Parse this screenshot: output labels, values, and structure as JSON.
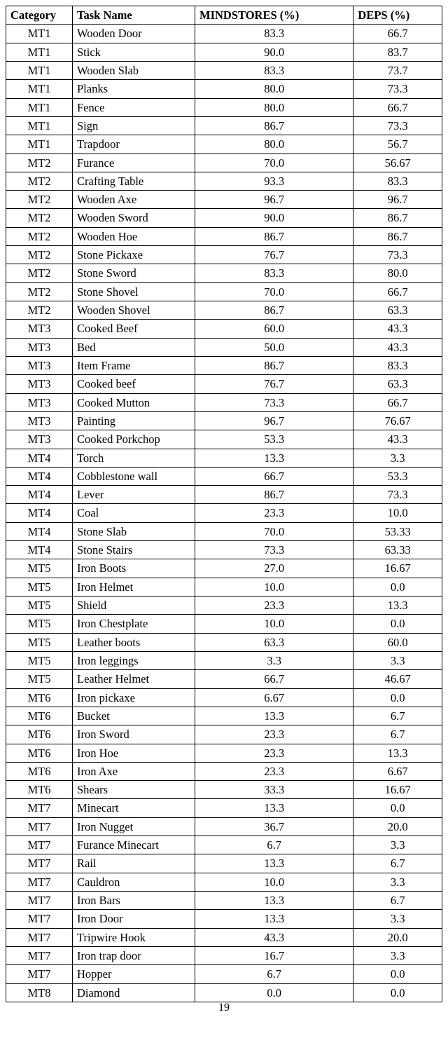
{
  "headers": {
    "category": "Category",
    "task": "Task Name",
    "mindstores": "MINDSTORES (%)",
    "deps": "DEPS (%)"
  },
  "rows": [
    {
      "category": "MT1",
      "task": "Wooden Door",
      "mindstores": "83.3",
      "deps": "66.7"
    },
    {
      "category": "MT1",
      "task": "Stick",
      "mindstores": "90.0",
      "deps": "83.7"
    },
    {
      "category": "MT1",
      "task": "Wooden Slab",
      "mindstores": "83.3",
      "deps": "73.7"
    },
    {
      "category": "MT1",
      "task": "Planks",
      "mindstores": "80.0",
      "deps": "73.3"
    },
    {
      "category": "MT1",
      "task": "Fence",
      "mindstores": "80.0",
      "deps": "66.7"
    },
    {
      "category": "MT1",
      "task": "Sign",
      "mindstores": "86.7",
      "deps": "73.3"
    },
    {
      "category": "MT1",
      "task": "Trapdoor",
      "mindstores": "80.0",
      "deps": "56.7"
    },
    {
      "category": "MT2",
      "task": "Furance",
      "mindstores": "70.0",
      "deps": "56.67"
    },
    {
      "category": "MT2",
      "task": "Crafting Table",
      "mindstores": "93.3",
      "deps": "83.3"
    },
    {
      "category": "MT2",
      "task": "Wooden Axe",
      "mindstores": "96.7",
      "deps": "96.7"
    },
    {
      "category": "MT2",
      "task": "Wooden Sword",
      "mindstores": "90.0",
      "deps": "86.7"
    },
    {
      "category": "MT2",
      "task": "Wooden Hoe",
      "mindstores": "86.7",
      "deps": "86.7"
    },
    {
      "category": "MT2",
      "task": "Stone Pickaxe",
      "mindstores": "76.7",
      "deps": "73.3"
    },
    {
      "category": "MT2",
      "task": "Stone Sword",
      "mindstores": "83.3",
      "deps": "80.0"
    },
    {
      "category": "MT2",
      "task": "Stone Shovel",
      "mindstores": "70.0",
      "deps": "66.7"
    },
    {
      "category": "MT2",
      "task": "Wooden Shovel",
      "mindstores": "86.7",
      "deps": "63.3"
    },
    {
      "category": "MT3",
      "task": "Cooked Beef",
      "mindstores": "60.0",
      "deps": "43.3"
    },
    {
      "category": "MT3",
      "task": "Bed",
      "mindstores": "50.0",
      "deps": "43.3"
    },
    {
      "category": "MT3",
      "task": "Item Frame",
      "mindstores": "86.7",
      "deps": "83.3"
    },
    {
      "category": "MT3",
      "task": "Cooked beef",
      "mindstores": "76.7",
      "deps": "63.3"
    },
    {
      "category": "MT3",
      "task": "Cooked Mutton",
      "mindstores": "73.3",
      "deps": "66.7"
    },
    {
      "category": "MT3",
      "task": "Painting",
      "mindstores": "96.7",
      "deps": "76.67"
    },
    {
      "category": "MT3",
      "task": "Cooked Porkchop",
      "mindstores": "53.3",
      "deps": "43.3"
    },
    {
      "category": "MT4",
      "task": "Torch",
      "mindstores": "13.3",
      "deps": "3.3"
    },
    {
      "category": "MT4",
      "task": "Cobblestone wall",
      "mindstores": "66.7",
      "deps": "53.3"
    },
    {
      "category": "MT4",
      "task": "Lever",
      "mindstores": "86.7",
      "deps": "73.3"
    },
    {
      "category": "MT4",
      "task": "Coal",
      "mindstores": "23.3",
      "deps": "10.0"
    },
    {
      "category": "MT4",
      "task": "Stone Slab",
      "mindstores": "70.0",
      "deps": "53.33"
    },
    {
      "category": "MT4",
      "task": "Stone Stairs",
      "mindstores": "73.3",
      "deps": "63.33"
    },
    {
      "category": "MT5",
      "task": "Iron Boots",
      "mindstores": "27.0",
      "deps": "16.67"
    },
    {
      "category": "MT5",
      "task": "Iron Helmet",
      "mindstores": "10.0",
      "deps": "0.0"
    },
    {
      "category": "MT5",
      "task": "Shield",
      "mindstores": "23.3",
      "deps": "13.3"
    },
    {
      "category": "MT5",
      "task": "Iron Chestplate",
      "mindstores": "10.0",
      "deps": "0.0"
    },
    {
      "category": "MT5",
      "task": "Leather boots",
      "mindstores": "63.3",
      "deps": "60.0"
    },
    {
      "category": "MT5",
      "task": "Iron leggings",
      "mindstores": "3.3",
      "deps": "3.3"
    },
    {
      "category": "MT5",
      "task": "Leather Helmet",
      "mindstores": "66.7",
      "deps": "46.67"
    },
    {
      "category": "MT6",
      "task": "Iron pickaxe",
      "mindstores": "6.67",
      "deps": "0.0"
    },
    {
      "category": "MT6",
      "task": "Bucket",
      "mindstores": "13.3",
      "deps": "6.7"
    },
    {
      "category": "MT6",
      "task": "Iron Sword",
      "mindstores": "23.3",
      "deps": "6.7"
    },
    {
      "category": "MT6",
      "task": "Iron Hoe",
      "mindstores": "23.3",
      "deps": "13.3"
    },
    {
      "category": "MT6",
      "task": "Iron Axe",
      "mindstores": "23.3",
      "deps": "6.67"
    },
    {
      "category": "MT6",
      "task": "Shears",
      "mindstores": "33.3",
      "deps": "16.67"
    },
    {
      "category": "MT7",
      "task": "Minecart",
      "mindstores": "13.3",
      "deps": "0.0"
    },
    {
      "category": "MT7",
      "task": "Iron Nugget",
      "mindstores": "36.7",
      "deps": "20.0"
    },
    {
      "category": "MT7",
      "task": "Furance Minecart",
      "mindstores": "6.7",
      "deps": "3.3"
    },
    {
      "category": "MT7",
      "task": "Rail",
      "mindstores": "13.3",
      "deps": "6.7"
    },
    {
      "category": "MT7",
      "task": "Cauldron",
      "mindstores": "10.0",
      "deps": "3.3"
    },
    {
      "category": "MT7",
      "task": "Iron Bars",
      "mindstores": "13.3",
      "deps": "6.7"
    },
    {
      "category": "MT7",
      "task": "Iron Door",
      "mindstores": "13.3",
      "deps": "3.3"
    },
    {
      "category": "MT7",
      "task": "Tripwire Hook",
      "mindstores": "43.3",
      "deps": "20.0"
    },
    {
      "category": "MT7",
      "task": "Iron trap door",
      "mindstores": "16.7",
      "deps": "3.3"
    },
    {
      "category": "MT7",
      "task": "Hopper",
      "mindstores": "6.7",
      "deps": "0.0"
    },
    {
      "category": "MT8",
      "task": "Diamond",
      "mindstores": "0.0",
      "deps": "0.0"
    }
  ],
  "page_number": "19"
}
